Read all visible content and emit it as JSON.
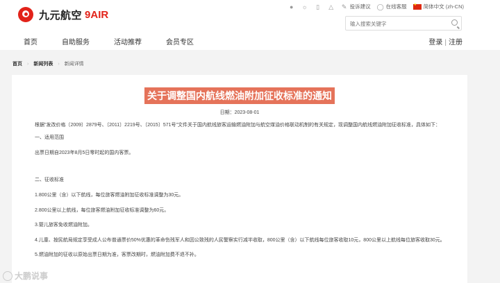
{
  "brand": {
    "name_cn": "九元航空",
    "name_en": "9AIR"
  },
  "utility": {
    "complaint": "投诉建议",
    "service": "在线客服",
    "language": "简体中文 (zh-CN)"
  },
  "search": {
    "placeholder": "输入搜索关键字"
  },
  "nav": {
    "items": [
      "首页",
      "自助服务",
      "活动推荐",
      "会员专区"
    ]
  },
  "auth": {
    "login": "登录",
    "sep": "|",
    "register": "注册"
  },
  "breadcrumb": {
    "home": "首页",
    "list": "新闻列表",
    "detail": "新闻详情",
    "arrow": "›"
  },
  "article": {
    "title": "关于调整国内航线燃油附加征收标准的通知",
    "date": "日期：2023-08-01",
    "paragraphs": [
      "根据\"发改价格〔2009〕2879号、〔2011〕2219号、〔2015〕571号\"文件关于国内航线旅客运输燃油附加与航空煤油价格联动机制的有关规定，现调整国内航线燃油附加征收标准，具体如下：",
      "一、适用范围",
      "出票日期自2023年8月5日零时起的国内客票。",
      "",
      "二、征收标准",
      "1.800公里（含）以下航线，每位旅客燃油附加征收标准调整为30元。",
      "2.800公里以上航线，每位旅客燃油附加征收标准调整为60元。",
      "3.婴儿旅客免收燃油附加。",
      "4.儿童、按民航局规定享受成人公布普通票价50%优惠的革命伤残军人和因公致残的人民警察实行减半收取，800公里（含）以下航线每位旅客收取10元，800公里以上航线每位旅客收取30元。",
      "5.燃油附加的征收以原始出票日期为准，客票改期时，燃油附加费不退不补。"
    ]
  },
  "watermark": "大鹏说事"
}
